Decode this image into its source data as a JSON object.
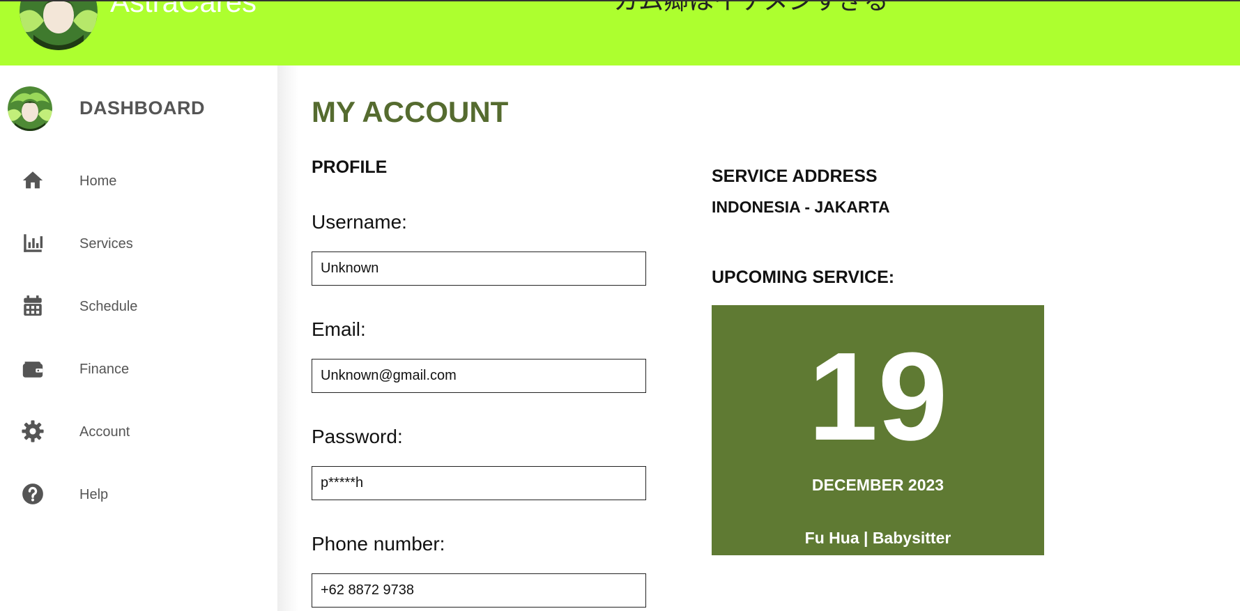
{
  "header": {
    "brand_name": "AstraCares",
    "tagline": "カム卿はイケメンすぎる",
    "background_color": "#adff2f"
  },
  "sidebar": {
    "title": "DASHBOARD",
    "items": [
      {
        "label": "Home",
        "icon": "home-icon"
      },
      {
        "label": "Services",
        "icon": "chart-bar-icon"
      },
      {
        "label": "Schedule",
        "icon": "calendar-icon"
      },
      {
        "label": "Finance",
        "icon": "wallet-icon"
      },
      {
        "label": "Account",
        "icon": "gear-icon"
      },
      {
        "label": "Help",
        "icon": "question-circle-icon"
      }
    ],
    "text_color": "#555555"
  },
  "main": {
    "title": "MY ACCOUNT",
    "title_color": "#556b2f",
    "profile": {
      "heading": "PROFILE",
      "fields": [
        {
          "label": "Username:",
          "value": "Unknown"
        },
        {
          "label": "Email:",
          "value": "Unknown@gmail.com"
        },
        {
          "label": "Password:",
          "value": "p*****h"
        },
        {
          "label": "Phone number:",
          "value": "+62 8872 9738"
        }
      ]
    },
    "service_address": {
      "heading": "SERVICE ADDRESS",
      "value": "INDONESIA - JAKARTA"
    },
    "upcoming_service": {
      "heading": "UPCOMING SERVICE:",
      "day": "19",
      "month_year": "DECEMBER 2023",
      "detail": "Fu Hua | Babysitter",
      "card_color": "#5f7a33"
    }
  }
}
